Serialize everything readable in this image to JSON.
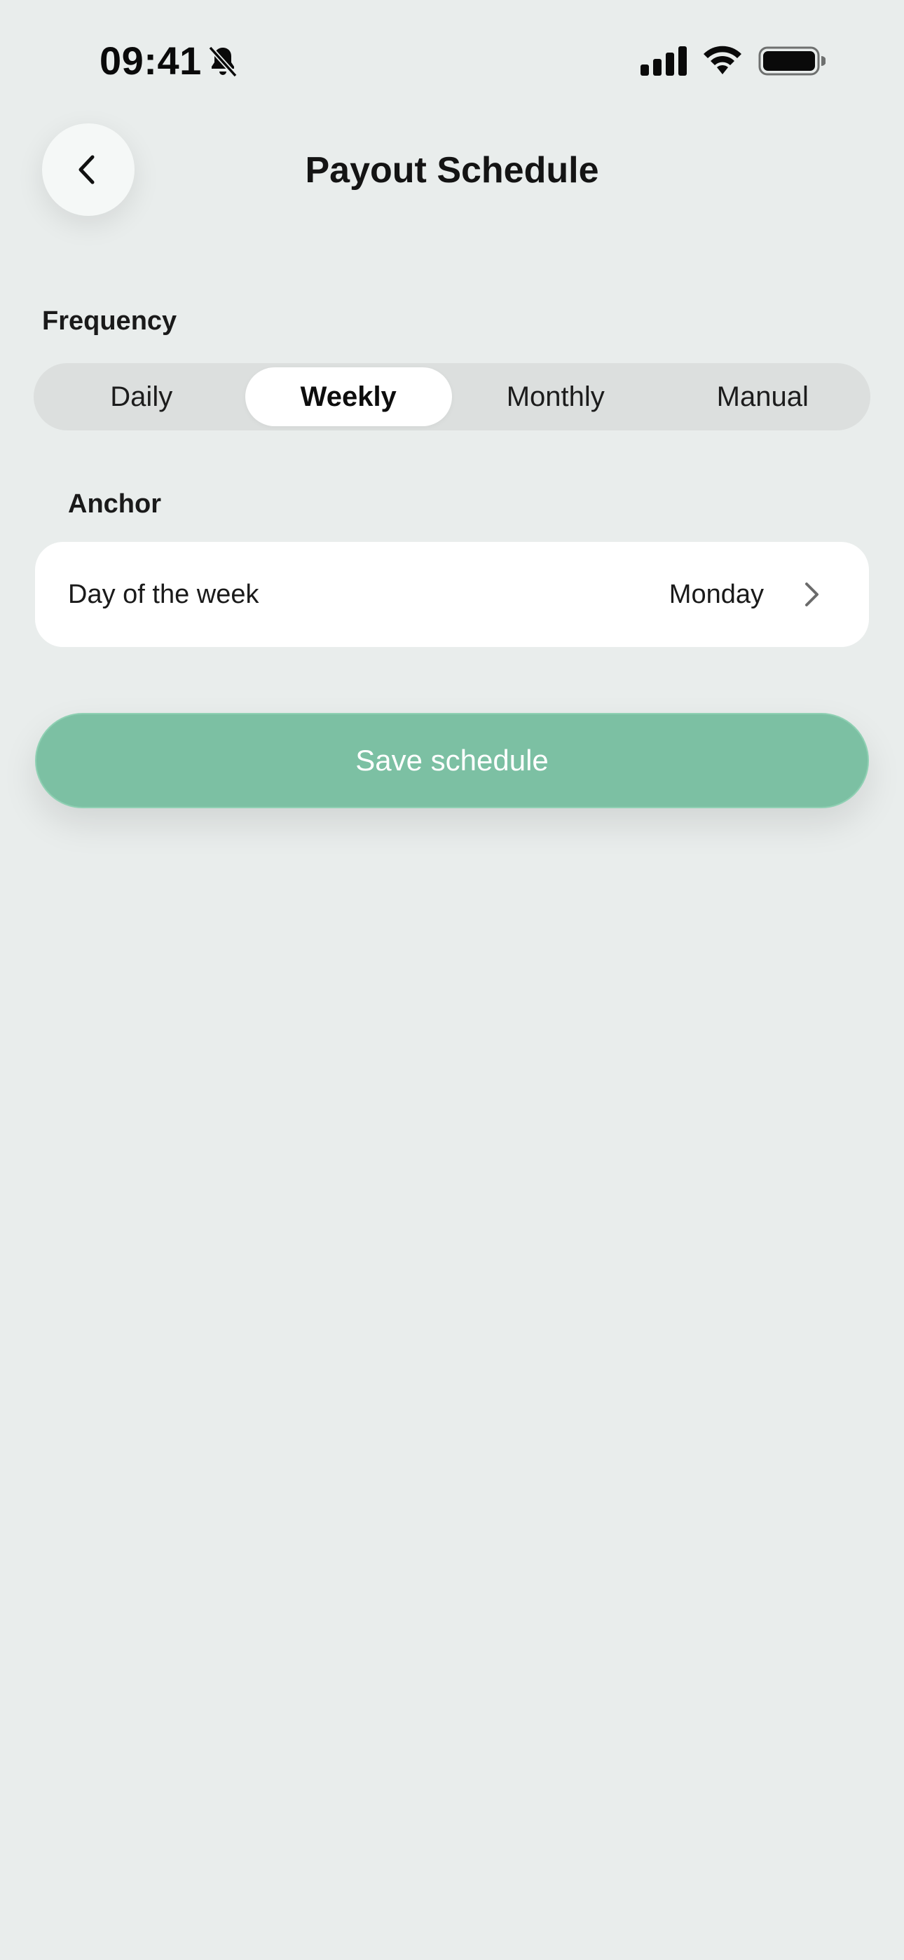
{
  "status_bar": {
    "time": "09:41",
    "icons": [
      "bell-slash-icon",
      "cellular-signal-icon",
      "wifi-icon",
      "battery-icon"
    ]
  },
  "header": {
    "back_icon": "chevron-left-icon",
    "title": "Payout Schedule"
  },
  "frequency": {
    "label": "Frequency",
    "options": [
      "Daily",
      "Weekly",
      "Monthly",
      "Manual"
    ],
    "selected": "Weekly"
  },
  "anchor": {
    "label": "Anchor",
    "row_label": "Day of the week",
    "row_value": "Monday",
    "row_icon": "chevron-right-icon"
  },
  "save": {
    "label": "Save schedule"
  },
  "colors": {
    "background": "#e9edec",
    "accent": "#7cc0a3",
    "segment_track": "#dcdfde",
    "card": "#ffffff"
  }
}
